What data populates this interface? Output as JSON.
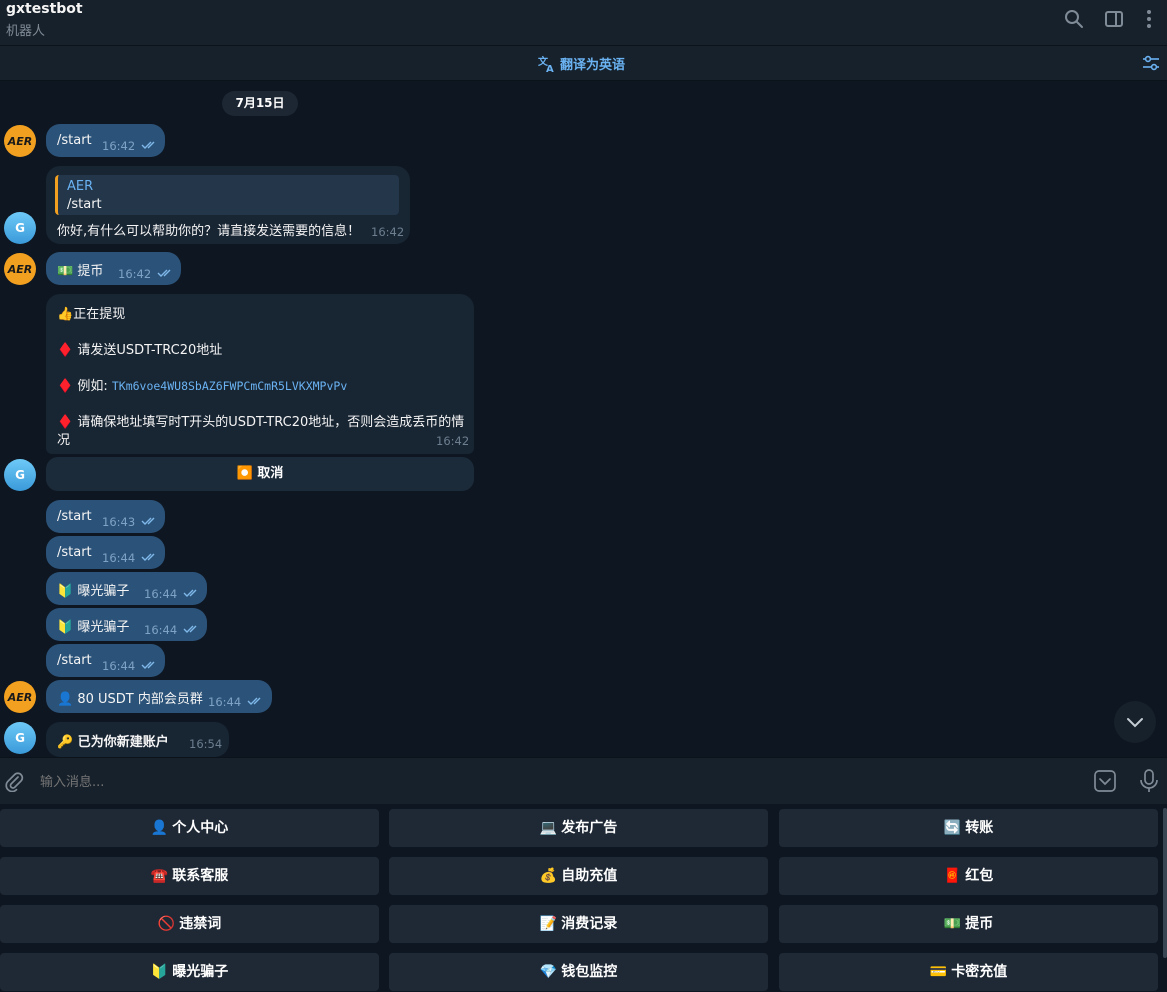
{
  "header": {
    "title": "gxtestbot",
    "subtitle": "机器人"
  },
  "translate_bar": {
    "label": "翻译为英语"
  },
  "chat": {
    "date": "7月15日",
    "avatar_aer": "AER",
    "avatar_g": "G",
    "messages": [
      {
        "text": "/start",
        "time": "16:42"
      },
      {
        "quote_name": "AER",
        "quote_text": "/start",
        "text": "你好,有什么可以帮助你的？请直接发送需要的信息！",
        "time": "16:42"
      },
      {
        "emoji": "💵",
        "text": "提币",
        "time": "16:42"
      },
      {
        "line1_emoji": "👍",
        "line1": "正在提现",
        "line2_emoji": "♦️",
        "line2": "请发送USDT-TRC20地址",
        "line3_emoji": "♦️",
        "line3_label": "例如: ",
        "line3_addr": "TKm6voe4WU8SbAZ6FWPCmCmR5LVKXMPvPv",
        "line4_emoji": "♦️",
        "line4a": "请确保地址填写时T开头的USDT-TRC20地址，否则会造成丢币的情",
        "line4b": "况",
        "time": "16:42",
        "button_emoji": "⏺️",
        "button": "取消"
      },
      {
        "text": "/start",
        "time": "16:43"
      },
      {
        "text": "/start",
        "time": "16:44"
      },
      {
        "emoji": "🔰",
        "text": "曝光骗子",
        "time": "16:44"
      },
      {
        "emoji": "🔰",
        "text": "曝光骗子",
        "time": "16:44"
      },
      {
        "text": "/start",
        "time": "16:44"
      },
      {
        "emoji": "👤",
        "text": "80 USDT 内部会员群",
        "time": "16:44"
      },
      {
        "emoji": "🔑",
        "text": "已为你新建账户",
        "time": "16:54"
      }
    ]
  },
  "input": {
    "placeholder": "输入消息..."
  },
  "keyboard": [
    {
      "emoji": "👤",
      "label": "个人中心"
    },
    {
      "emoji": "💻",
      "label": "发布广告"
    },
    {
      "emoji": "🔄",
      "label": "转账"
    },
    {
      "emoji": "☎️",
      "label": "联系客服"
    },
    {
      "emoji": "💰",
      "label": "自助充值"
    },
    {
      "emoji": "🧧",
      "label": "红包"
    },
    {
      "emoji": "🚫",
      "label": "违禁词"
    },
    {
      "emoji": "📝",
      "label": "消费记录"
    },
    {
      "emoji": "💵",
      "label": "提币"
    },
    {
      "emoji": "🔰",
      "label": "曝光骗子"
    },
    {
      "emoji": "💎",
      "label": "钱包监控"
    },
    {
      "emoji": "💳",
      "label": "卡密充值"
    }
  ],
  "colors": {
    "accent": "#6ab2f2",
    "outgoing": "#2b5278",
    "incoming": "#182533",
    "background": "#0e1621"
  }
}
